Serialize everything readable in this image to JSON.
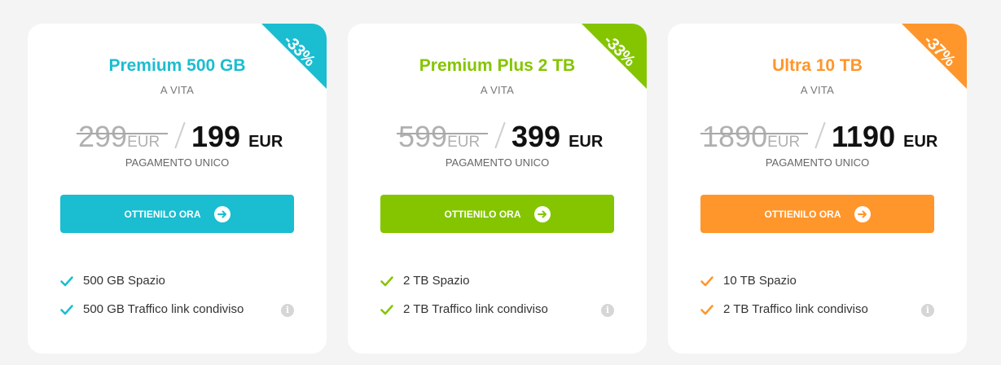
{
  "plans": [
    {
      "title": "Premium 500 GB",
      "subtitle": "A VITA",
      "discount": "-33%",
      "old_price": "299",
      "old_currency": "EUR",
      "price": "199",
      "currency": "EUR",
      "payment_note": "PAGAMENTO UNICO",
      "button_label": "OTTIENILO ORA",
      "accent": "#1bbdd0",
      "features": [
        "500 GB Spazio",
        "500 GB Traffico link condiviso"
      ]
    },
    {
      "title": "Premium Plus 2 TB",
      "subtitle": "A VITA",
      "discount": "-33%",
      "old_price": "599",
      "old_currency": "EUR",
      "price": "399",
      "currency": "EUR",
      "payment_note": "PAGAMENTO UNICO",
      "button_label": "OTTIENILO ORA",
      "accent": "#84c500",
      "features": [
        "2 TB Spazio",
        "2 TB Traffico link condiviso"
      ]
    },
    {
      "title": "Ultra 10 TB",
      "subtitle": "A VITA",
      "discount": "-37%",
      "old_price": "1890",
      "old_currency": "EUR",
      "price": "1190",
      "currency": "EUR",
      "payment_note": "PAGAMENTO UNICO",
      "button_label": "OTTIENILO ORA",
      "accent": "#ff962b",
      "features": [
        "10 TB Spazio",
        "2 TB Traffico link condiviso"
      ]
    }
  ],
  "icons": {
    "button": "arrow-right-circle-icon",
    "feature": "check-icon",
    "info": "info-icon"
  }
}
